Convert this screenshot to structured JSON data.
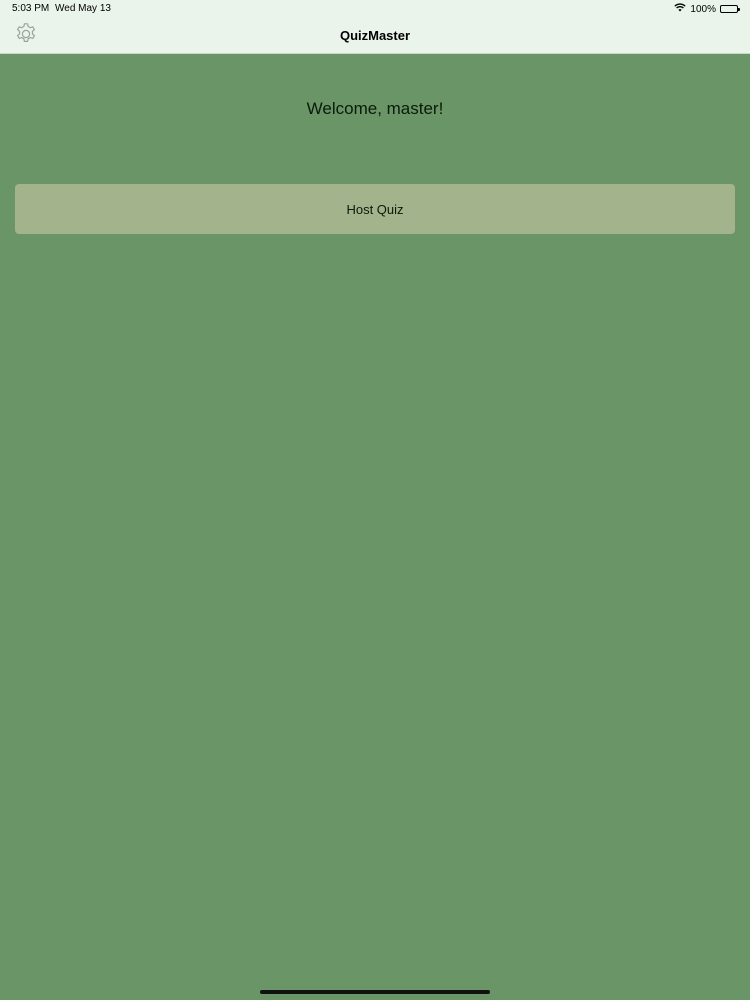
{
  "status_bar": {
    "time": "5:03 PM",
    "date": "Wed May 13",
    "battery": "100%",
    "wifi_icon": "wifi-icon",
    "battery_icon": "battery-icon"
  },
  "nav": {
    "title": "QuizMaster",
    "settings_icon": "gear-icon"
  },
  "main": {
    "welcome": "Welcome, master!",
    "host_button_label": "Host Quiz"
  },
  "colors": {
    "background": "#6a9567",
    "nav_background": "#eaf4ea",
    "button_background": "#a3b38b"
  }
}
